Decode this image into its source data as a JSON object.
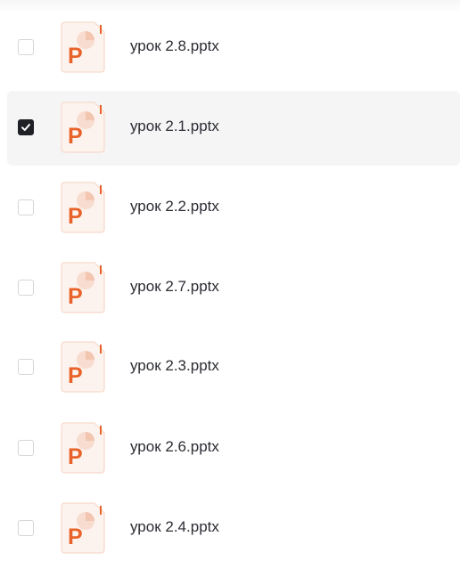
{
  "files": [
    {
      "name": "урок 2.8.pptx",
      "checked": false,
      "selected": false,
      "icon": "powerpoint-file-icon"
    },
    {
      "name": "урок 2.1.pptx",
      "checked": true,
      "selected": true,
      "icon": "powerpoint-file-icon"
    },
    {
      "name": "урок 2.2.pptx",
      "checked": false,
      "selected": false,
      "icon": "powerpoint-file-icon"
    },
    {
      "name": "урок 2.7.pptx",
      "checked": false,
      "selected": false,
      "icon": "powerpoint-file-icon"
    },
    {
      "name": "урок 2.3.pptx",
      "checked": false,
      "selected": false,
      "icon": "powerpoint-file-icon"
    },
    {
      "name": "урок 2.6.pptx",
      "checked": false,
      "selected": false,
      "icon": "powerpoint-file-icon"
    },
    {
      "name": "урок 2.4.pptx",
      "checked": false,
      "selected": false,
      "icon": "powerpoint-file-icon"
    }
  ],
  "icon_letter": "P",
  "colors": {
    "accent": "#e8622a",
    "icon_bg": "#fdf3ee",
    "icon_border": "#f6d9cb",
    "check_fill": "#1f2026",
    "selected_row_bg": "#f5f5f6"
  }
}
